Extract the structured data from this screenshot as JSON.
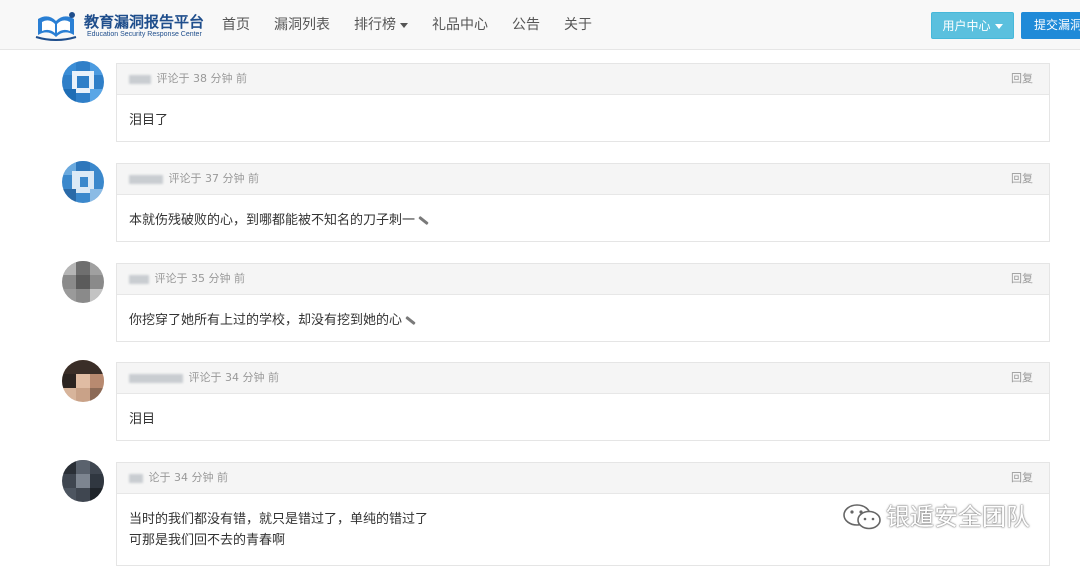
{
  "navbar": {
    "logo_title": "教育漏洞报告平台",
    "logo_subtitle": "Education Security Response Center",
    "links": [
      "首页",
      "漏洞列表",
      "排行榜",
      "礼品中心",
      "公告",
      "关于"
    ],
    "user_center": "用户中心",
    "submit": "提交漏洞"
  },
  "comments": [
    {
      "meta": "评论于 38 分钟 前",
      "reply": "回复",
      "lines": [
        "泪目了"
      ],
      "knife": false
    },
    {
      "meta": "评论于 37 分钟 前",
      "reply": "回复",
      "lines": [
        "本就伤残破败的心，到哪都能被不知名的刀子刺一"
      ],
      "knife": true
    },
    {
      "meta": "评论于 35 分钟 前",
      "reply": "回复",
      "lines": [
        "你挖穿了她所有上过的学校，却没有挖到她的心"
      ],
      "knife": true
    },
    {
      "meta": "评论于 34 分钟 前",
      "reply": "回复",
      "lines": [
        "泪目"
      ],
      "knife": false
    },
    {
      "meta": "论于 34 分钟 前",
      "reply": "回复",
      "lines": [
        "当时的我们都没有错，就只是错过了，单纯的错过了",
        "可那是我们回不去的青春啊"
      ],
      "knife": false
    }
  ],
  "watermark": "银遁安全团队",
  "colors": {
    "brand": "#1f4e8c",
    "info_button": "#5bc0de",
    "primary_button": "#1f8ad8"
  }
}
